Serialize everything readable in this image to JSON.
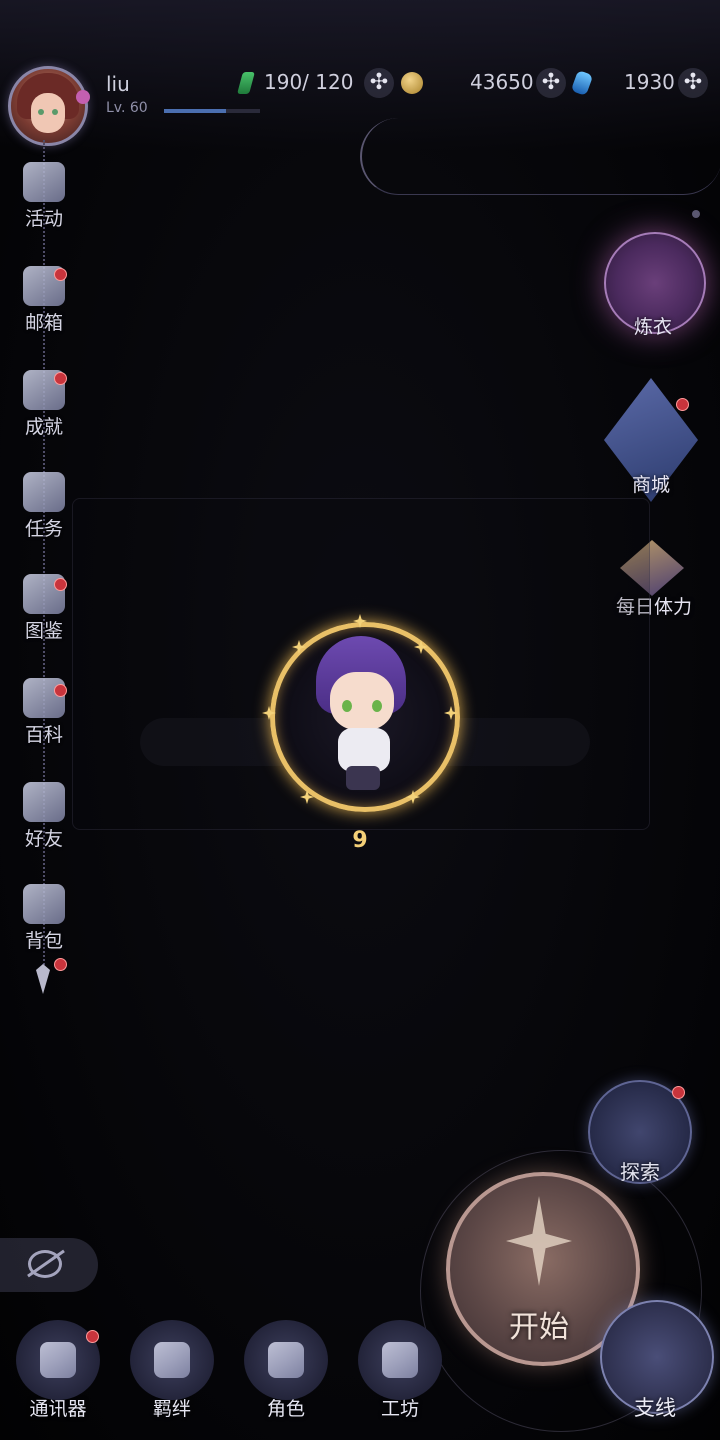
{
  "player": {
    "name": "liu",
    "level": "Lv. 60",
    "xp_fraction": 0.65
  },
  "resources": {
    "stamina": "190/ 120",
    "coins": "43650",
    "gems": "1930",
    "plus_symbol": "✣"
  },
  "sidebar": {
    "items": [
      {
        "label": "活动",
        "icon": "megaphone-icon",
        "badge": false
      },
      {
        "label": "邮箱",
        "icon": "mail-icon",
        "badge": true
      },
      {
        "label": "成就",
        "icon": "banner-icon",
        "badge": true
      },
      {
        "label": "任务",
        "icon": "checklist-icon",
        "badge": false
      },
      {
        "label": "图鉴",
        "icon": "d20-icon",
        "badge": true
      },
      {
        "label": "百科",
        "icon": "book-icon",
        "badge": true
      },
      {
        "label": "好友",
        "icon": "handshake-icon",
        "badge": false
      },
      {
        "label": "背包",
        "icon": "bag-icon",
        "badge": false
      }
    ]
  },
  "right_menu": {
    "lianyi": "炼衣",
    "shop": "商城",
    "daily_stamina": "每日体力"
  },
  "loading": {
    "count": "9"
  },
  "actions": {
    "explore": "探索",
    "start": "开始",
    "branch": "支线"
  },
  "bottom_nav": [
    {
      "label": "通讯器",
      "icon": "communicator-icon",
      "badge": true
    },
    {
      "label": "羁绊",
      "icon": "heart-icon",
      "badge": false
    },
    {
      "label": "角色",
      "icon": "character-icon",
      "badge": false
    },
    {
      "label": "工坊",
      "icon": "gear-icon",
      "badge": false
    }
  ],
  "colors": {
    "badge": "#c8343c",
    "gold": "#f4d078",
    "background": "#050508"
  }
}
